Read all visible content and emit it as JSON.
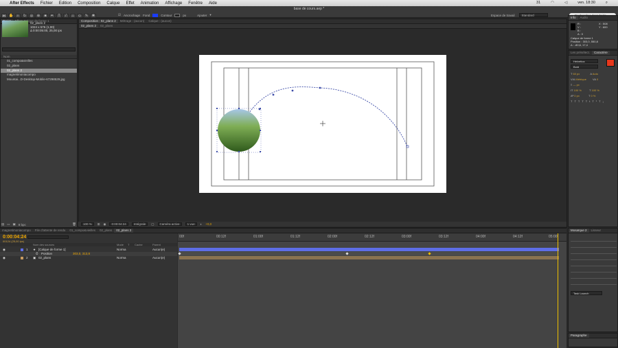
{
  "menubar": {
    "app": "After Effects",
    "items": [
      "Fichier",
      "Edition",
      "Composition",
      "Calque",
      "Effet",
      "Animation",
      "Affichage",
      "Fenêtre",
      "Aide"
    ],
    "clock": "ven. 18:30",
    "extras": [
      "31"
    ]
  },
  "window_title": "base de cours.aep *",
  "toolbar": {
    "options": [
      "Ancrochage",
      "Fond",
      "Contour",
      "Ajouter"
    ],
    "fond_color": "#1a3cff",
    "contour_unit": "px",
    "workspace_label": "Espace de travail",
    "workspace_value": "Standard",
    "search_placeholder": "Rechercher dans l'aide"
  },
  "project": {
    "tabs": [
      "Projet",
      "Effets Calque de forme 1"
    ],
    "selected_name": "02_plans 2",
    "info_lines": [
      "1024 x 576 (1,00)",
      "Δ 0:00:05:00, 25,00 ips"
    ],
    "header": "Nom",
    "items": [
      {
        "name": "01_compo&vieilles",
        "selected": false
      },
      {
        "name": "02_plans",
        "selected": false
      },
      {
        "name": "02_plans 2",
        "selected": true
      },
      {
        "name": "magnetimoniacompo",
        "selected": false
      },
      {
        "name": "Mountai...D-Desktop-Mobile-67298529.jpg",
        "selected": false
      }
    ],
    "bpc": "8 bpc"
  },
  "viewer": {
    "tabs": [
      "Composition : 02_plans 2",
      "Métrage : (aucun)",
      "Calque : (aucun)"
    ],
    "subtabs": [
      "02_plans 2",
      "02_plans"
    ],
    "zoom": "100 %",
    "timecode": "0:00:04:24",
    "quality": "Intégrale",
    "camera": "Caméra active",
    "views": "1 vue",
    "exposure": "+0,0"
  },
  "info_panel": {
    "tabs": [
      "Info",
      "Audio"
    ],
    "r": "R :",
    "g": "V :",
    "b": "B :",
    "a": "A : 0",
    "x": "X : 508",
    "y": "Y : 600",
    "layer": "Calque de forme 1",
    "position": "Position : 303,0, 550,8",
    "delta": "Δ : -80,6, 17,4"
  },
  "character_panel": {
    "tabs": [
      "Les présélect.",
      "Caractère"
    ],
    "font": "Helvetica",
    "style": "Bold",
    "size": "60 px",
    "leading": "Auto",
    "tracking": "Métrique",
    "kerning": "0",
    "stroke": "— px",
    "vscale": "100 %",
    "hscale": "100 %",
    "baseline": "0 px",
    "tsume": "0 %",
    "color_fill": "#e8381c"
  },
  "right_lower": {
    "tabs": [
      "Mosaïque 2",
      "Lisseur"
    ],
    "task_label": "Task Launch",
    "para_tab": "Paragraphe"
  },
  "timeline": {
    "tabs": [
      "magnetimoniacompo",
      "File d'attente de rendu",
      "01_compo&vieilles",
      "02_plans",
      "02_plans 2"
    ],
    "timecode": "0:00:04:24",
    "fps": "00124 (25,00 ips)",
    "columns": [
      "Nom des sources",
      "Mode",
      "T",
      "Cache",
      "Parent"
    ],
    "layers": [
      {
        "num": "1",
        "name": "[Calque de forme 1]",
        "mode": "Norma",
        "parent": "Aucun(e)",
        "color": "#5e6ee6"
      },
      {
        "num": "",
        "name": "Position",
        "value": "303,0, 313,8",
        "mode": "",
        "parent": "",
        "color": ""
      },
      {
        "num": "2",
        "name": "02_plans",
        "mode": "Norma",
        "parent": "Aucun(e)",
        "color": "#c89b5f"
      }
    ],
    "ruler_labels": [
      "00f",
      "00:12f",
      "01:00f",
      "01:12f",
      "02:00f",
      "02:12f",
      "03:00f",
      "03:12f",
      "04:00f",
      "04:12f",
      "05:00f"
    ]
  }
}
